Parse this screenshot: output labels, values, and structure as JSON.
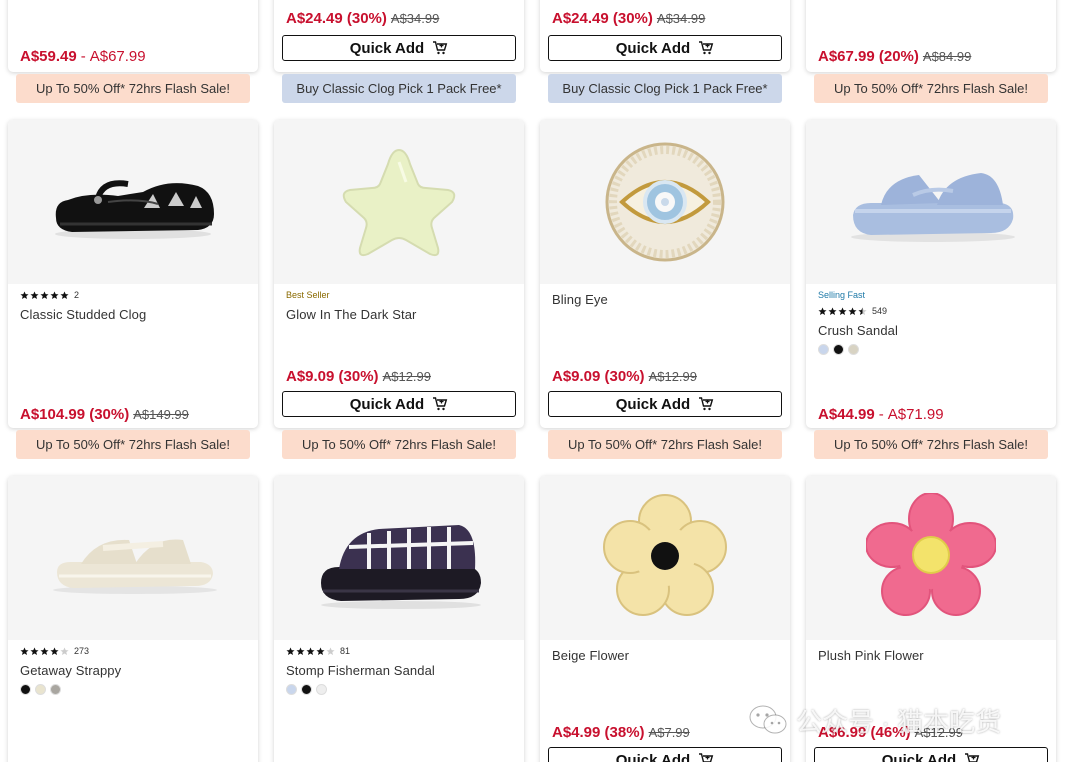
{
  "colors": {
    "sale_red": "#c8102e",
    "flash_bg": "#fcdccc",
    "classic_bg": "#ccd7ea"
  },
  "quick_add_label": "Quick Add",
  "row0": [
    {
      "price_sale": "A$59.49",
      "price_sep": "-",
      "price_max": "A$67.99",
      "promo": "Up To 50% Off* 72hrs Flash Sale!"
    },
    {
      "price_sale": "A$24.49 (30%)",
      "price_orig": "A$34.99",
      "promo": "Buy Classic Clog Pick 1 Pack Free*"
    },
    {
      "price_sale": "A$24.49 (30%)",
      "price_orig": "A$34.99",
      "promo": "Buy Classic Clog Pick 1 Pack Free*"
    },
    {
      "price_sale": "A$67.99 (20%)",
      "price_orig": "A$84.99",
      "promo": "Up To 50% Off* 72hrs Flash Sale!"
    }
  ],
  "row1": [
    {
      "name": "Classic Studded Clog",
      "rating": 5,
      "reviews": "2",
      "price_sale": "A$104.99 (30%)",
      "price_orig": "A$149.99",
      "promo": "Up To 50% Off* 72hrs Flash Sale!",
      "image_icon": "black-clog-icon"
    },
    {
      "name": "Glow In The Dark Star",
      "badge": "Best Seller",
      "price_sale": "A$9.09 (30%)",
      "price_orig": "A$12.99",
      "promo": "Up To 50% Off* 72hrs Flash Sale!",
      "image_icon": "star-charm-icon"
    },
    {
      "name": "Bling Eye",
      "price_sale": "A$9.09 (30%)",
      "price_orig": "A$12.99",
      "promo": "Up To 50% Off* 72hrs Flash Sale!",
      "image_icon": "eye-charm-icon"
    },
    {
      "name": "Crush Sandal",
      "badge": "Selling Fast",
      "rating": 4.5,
      "reviews": "549",
      "swatches": [
        "#c9d6ec",
        "#111111",
        "#d8d3c3"
      ],
      "price_sale": "A$44.99",
      "price_sep": "-",
      "price_max": "A$71.99",
      "promo": "Up To 50% Off* 72hrs Flash Sale!",
      "image_icon": "blue-sandal-icon"
    }
  ],
  "row2": [
    {
      "name": "Getaway Strappy",
      "rating": 4,
      "reviews": "273",
      "swatches": [
        "#111111",
        "#e9e4cf",
        "#a9a6a0"
      ],
      "image_icon": "white-sandal-icon"
    },
    {
      "name": "Stomp Fisherman Sandal",
      "rating": 4,
      "reviews": "81",
      "swatches": [
        "#c9d6ec",
        "#111111",
        "#eeeeee"
      ],
      "image_icon": "purple-fisherman-icon"
    },
    {
      "name": "Beige Flower",
      "price_sale": "A$4.99 (38%)",
      "price_orig": "A$7.99",
      "image_icon": "beige-flower-icon"
    },
    {
      "name": "Plush Pink Flower",
      "price_sale": "A$6.99 (46%)",
      "price_orig": "A$12.99",
      "image_icon": "pink-flower-icon"
    }
  ],
  "watermark": {
    "text": "公众号 · 猫本吃货",
    "icon": "wechat-icon"
  }
}
